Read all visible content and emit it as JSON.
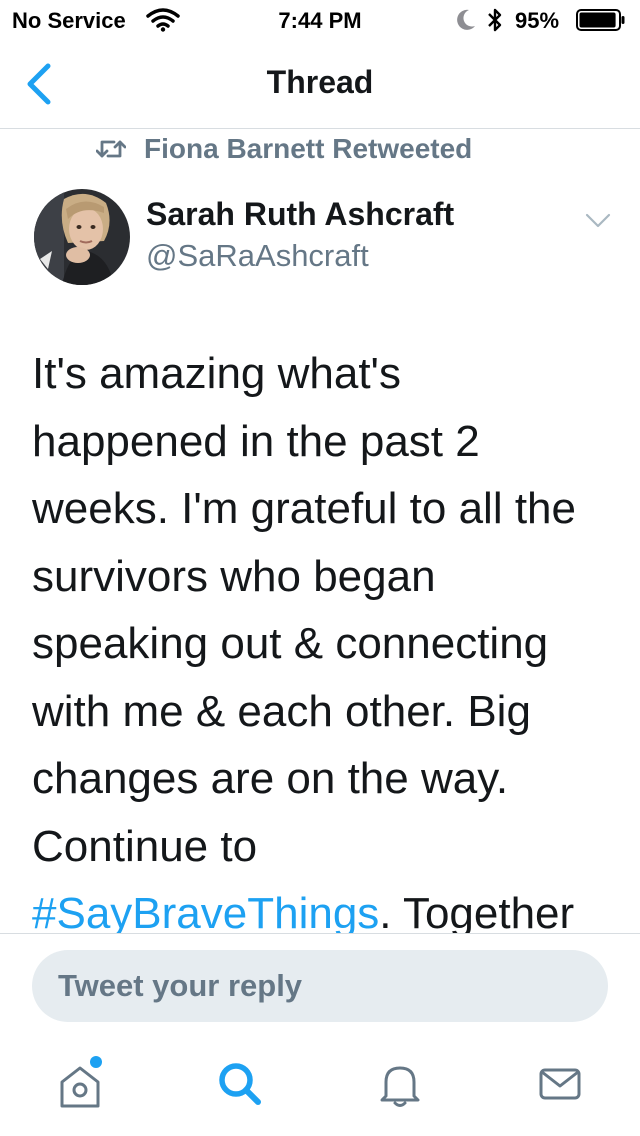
{
  "status_bar": {
    "carrier": "No Service",
    "time": "7:44 PM",
    "battery_percent": "95%",
    "battery_level": 0.95,
    "icons": [
      "wifi-icon",
      "moon-icon",
      "bluetooth-icon",
      "battery-icon"
    ]
  },
  "nav": {
    "title": "Thread",
    "back_icon": "chevron-left-icon"
  },
  "tweet": {
    "retweet_label": "Fiona Barnett Retweeted",
    "author_name": "Sarah Ruth Ashcraft",
    "author_handle": "@SaRaAshcraft",
    "text_lines": [
      "It's amazing what's",
      "happened in the past 2",
      "weeks. I'm grateful to all the",
      "survivors who began",
      "speaking out & connecting",
      "with me & each other. Big",
      "changes are on the way.",
      "Continue to"
    ],
    "last_line_hashtag": "#SayBraveThings",
    "last_line_rest": ". Together"
  },
  "reply": {
    "placeholder": "Tweet your reply"
  },
  "tab_bar": {
    "items": [
      "home-icon",
      "search-icon",
      "notifications-icon",
      "messages-icon"
    ],
    "active": "search-icon"
  },
  "colors": {
    "accent": "#1da1f2",
    "secondary_text": "#657786",
    "primary_text": "#14171a",
    "reply_bg": "#e6ecf0"
  }
}
